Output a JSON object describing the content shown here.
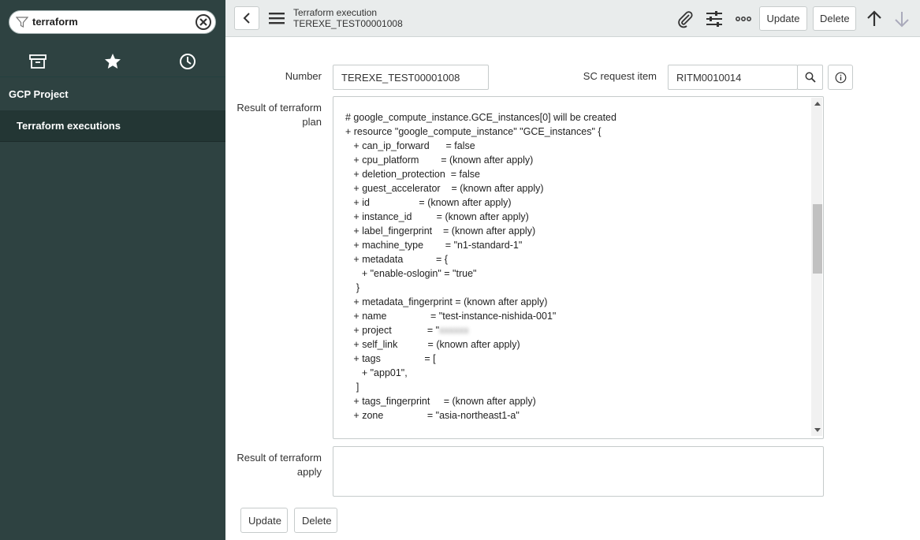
{
  "sidebar": {
    "filter_value": "terraform",
    "section": "GCP Project",
    "item": "Terraform executions"
  },
  "header": {
    "title": "Terraform execution",
    "subtitle": "TEREXE_TEST00001008",
    "update_label": "Update",
    "delete_label": "Delete"
  },
  "form": {
    "number_label": "Number",
    "number_value": "TEREXE_TEST00001008",
    "sc_label": "SC request item",
    "sc_value": "RITM0010014",
    "plan_label_1": "Result of terraform",
    "plan_label_2": "plan",
    "apply_label_1": "Result of terraform",
    "apply_label_2": "apply",
    "plan_lines": [
      "# google_compute_instance.GCE_instances[0] will be created",
      "+ resource \"google_compute_instance\" \"GCE_instances\" {",
      "   + can_ip_forward      = false",
      "   + cpu_platform        = (known after apply)",
      "   + deletion_protection  = false",
      "   + guest_accelerator    = (known after apply)",
      "   + id                  = (known after apply)",
      "   + instance_id         = (known after apply)",
      "   + label_fingerprint    = (known after apply)",
      "   + machine_type        = \"n1-standard-1\"",
      "   + metadata            = {",
      "      + \"enable-oslogin\" = \"true\"",
      "    }",
      "   + metadata_fingerprint = (known after apply)",
      "   + name                = \"test-instance-nishida-001\"",
      "   + project             = \"",
      "   + self_link           = (known after apply)",
      "   + tags                = [",
      "      + \"app01\",",
      "    ]",
      "   + tags_fingerprint     = (known after apply)",
      "   + zone                = \"asia-northeast1-a\""
    ],
    "update_label": "Update",
    "delete_label": "Delete"
  }
}
